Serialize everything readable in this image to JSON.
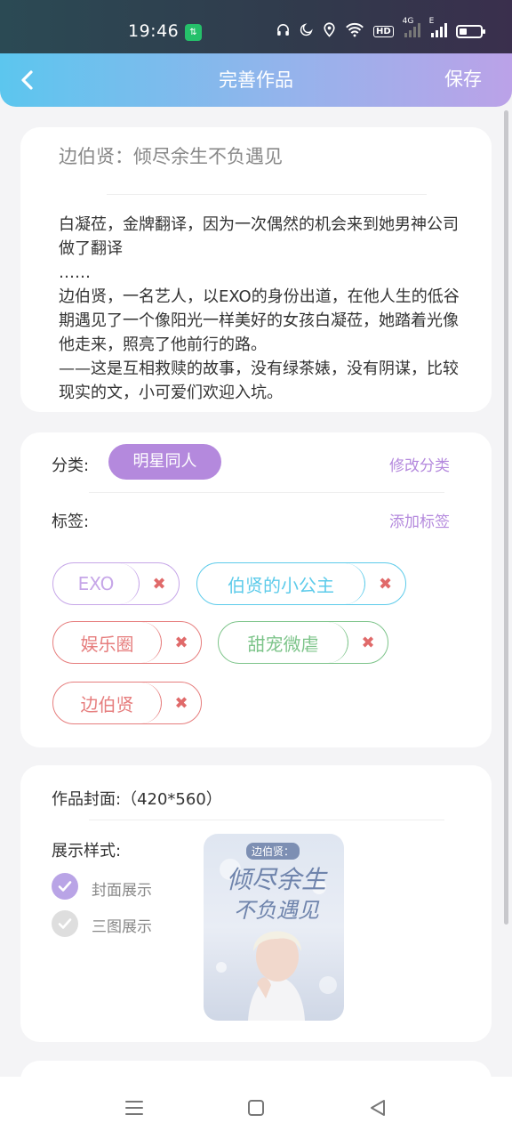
{
  "status_bar": {
    "time": "19:46",
    "app_badge": "⇅",
    "network_4g": "4G",
    "network_e": "E",
    "hd": "HD"
  },
  "header": {
    "title": "完善作品",
    "save_label": "保存"
  },
  "work": {
    "title": "边伯贤：倾尽余生不负遇见",
    "synopsis": "白凝莅，金牌翻译，因为一次偶然的机会来到她男神公司做了翻译\n……\n边伯贤，一名艺人，以EXO的身份出道，在他人生的低谷期遇见了一个像阳光一样美好的女孩白凝莅，她踏着光像他走来，照亮了他前行的路。\n——这是互相救赎的故事，没有绿茶婊，没有阴谋，比较现实的文，小可爱们欢迎入坑。"
  },
  "category": {
    "label": "分类:",
    "value": "明星同人",
    "change_label": "修改分类"
  },
  "tags": {
    "label": "标签:",
    "add_label": "添加标签",
    "items": [
      {
        "text": "EXO",
        "color": "#c6a6e8"
      },
      {
        "text": "伯贤的小公主",
        "color": "#5dcbea"
      },
      {
        "text": "娱乐圈",
        "color": "#e67d7d"
      },
      {
        "text": "甜宠微虐",
        "color": "#7dc48a"
      },
      {
        "text": "边伯贤",
        "color": "#e67d7d"
      }
    ],
    "remove_glyph": "✖"
  },
  "cover": {
    "label": "作品封面:（420*560）",
    "style_label": "展示样式:",
    "options": [
      {
        "label": "封面展示",
        "selected": true
      },
      {
        "label": "三图展示",
        "selected": false
      }
    ],
    "image_tag": "边伯贤：",
    "image_title_1": "倾尽余生",
    "image_title_2": "不负遇见"
  },
  "colors": {
    "accent": "#b489dd",
    "header_start": "#5cc6ee",
    "header_end": "#bba2e8"
  }
}
